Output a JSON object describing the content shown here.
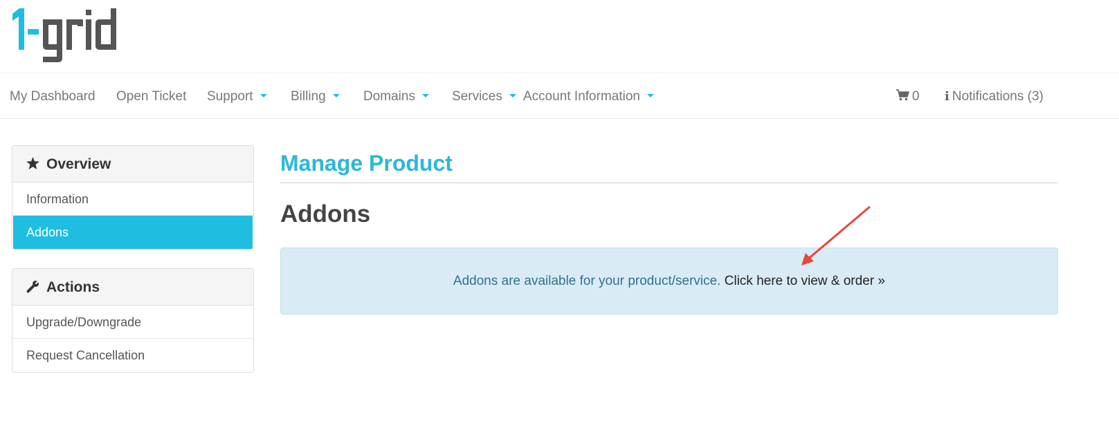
{
  "logo": {
    "text": "1-grid",
    "primary_color": "#1fbde0",
    "secondary_color": "#555555"
  },
  "nav": {
    "items": [
      {
        "label": "My Dashboard",
        "dropdown": false
      },
      {
        "label": "Open Ticket",
        "dropdown": false
      },
      {
        "label": "Support",
        "dropdown": true
      },
      {
        "label": "Billing",
        "dropdown": true
      },
      {
        "label": "Domains",
        "dropdown": true
      },
      {
        "label": "Services",
        "dropdown": true
      },
      {
        "label": "Account Information",
        "dropdown": true
      }
    ],
    "cart_count": "0",
    "cart_icon": "shopping-cart-icon",
    "notifications_label": "Notifications (3)",
    "notifications_icon": "info-icon",
    "accent_color": "#1fbde0"
  },
  "sidebar": {
    "overview": {
      "heading": "Overview",
      "icon": "star-icon",
      "items": [
        {
          "label": "Information",
          "active": false
        },
        {
          "label": "Addons",
          "active": true
        }
      ]
    },
    "actions": {
      "heading": "Actions",
      "icon": "wrench-icon",
      "items": [
        {
          "label": "Upgrade/Downgrade"
        },
        {
          "label": "Request Cancellation"
        }
      ]
    }
  },
  "main": {
    "title": "Manage Product",
    "section_title": "Addons",
    "alert_text": "Addons are available for your product/service.",
    "alert_link": "Click here to view & order »",
    "annotation_color": "#e8463a"
  }
}
